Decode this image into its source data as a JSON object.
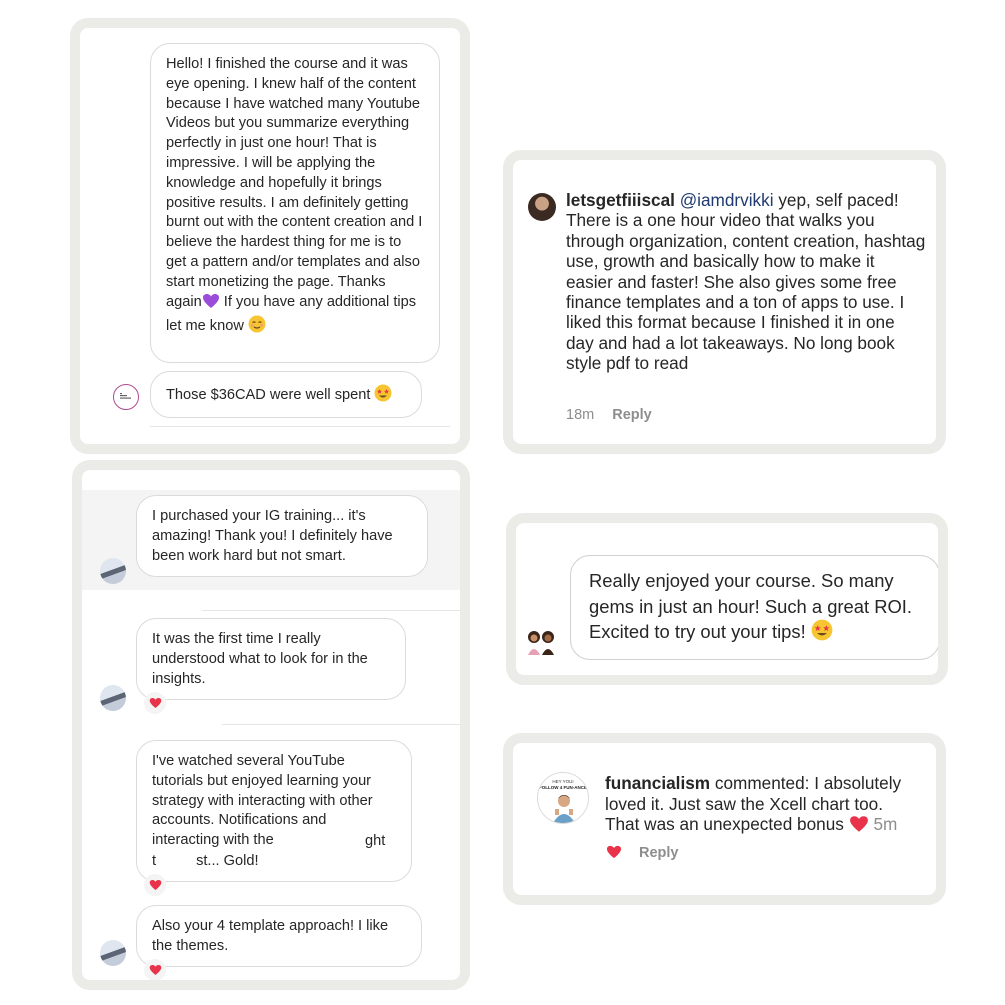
{
  "card1": {
    "message1": "Hello! I finished the course and it was eye opening. I knew half of the content because I have watched many Youtube Videos but you summarize everything perfectly in just one hour! That is impressive. I will be applying the knowledge and hopefully it brings positive results. I am definitely getting burnt out with the content creation and I believe the hardest thing for me is to get a pattern and/or templates and also start monetizing the page. Thanks again",
    "message1_tail": "If you have any additional tips let me know",
    "message2": "Those $36CAD were well spent"
  },
  "card2": {
    "username": "letsgetfiiiscal",
    "mention": "@iamdrvikki",
    "comment": "yep, self paced! There is a one hour video that walks you through organization, content creation, hashtag use, growth and basically how to make it easier and faster! She also gives some free finance templates and a ton of apps to use. I liked this format because I finished it in one day and had a lot takeaways. No long book style pdf to read",
    "time": "18m",
    "reply": "Reply"
  },
  "card3": {
    "messages": [
      "I purchased your IG training... it's amazing! Thank you! I definitely have been work hard but not smart.",
      "It was the first time I really understood what to look for in the insights.",
      "I've watched several YouTube tutorials but enjoyed learning your strategy with interacting with other accounts. Notifications and interacting with the",
      "Also your 4 template approach! I like the themes."
    ],
    "partial_line_a": "ght",
    "partial_line_b1": "t",
    "partial_line_b2": "st... Gold!"
  },
  "card4": {
    "message": "Really enjoyed your course. So many gems in just an hour! Such a great ROI. Excited to try out  your tips!"
  },
  "card5": {
    "username": "funancialism",
    "comment": "commented: I absolutely loved it.  Just saw the Xcell chart too. That was an unexpected bonus",
    "time": "5m",
    "reply": "Reply",
    "avatar_text_top": "HEY YOU!",
    "avatar_text": "FOLLOW 4 FUN-ANCE"
  },
  "colors": {
    "frame": "#ebebe7",
    "heart": "#e8334a",
    "purple_heart": "#9b4dd9",
    "emoji_yellow": "#f7c531"
  }
}
